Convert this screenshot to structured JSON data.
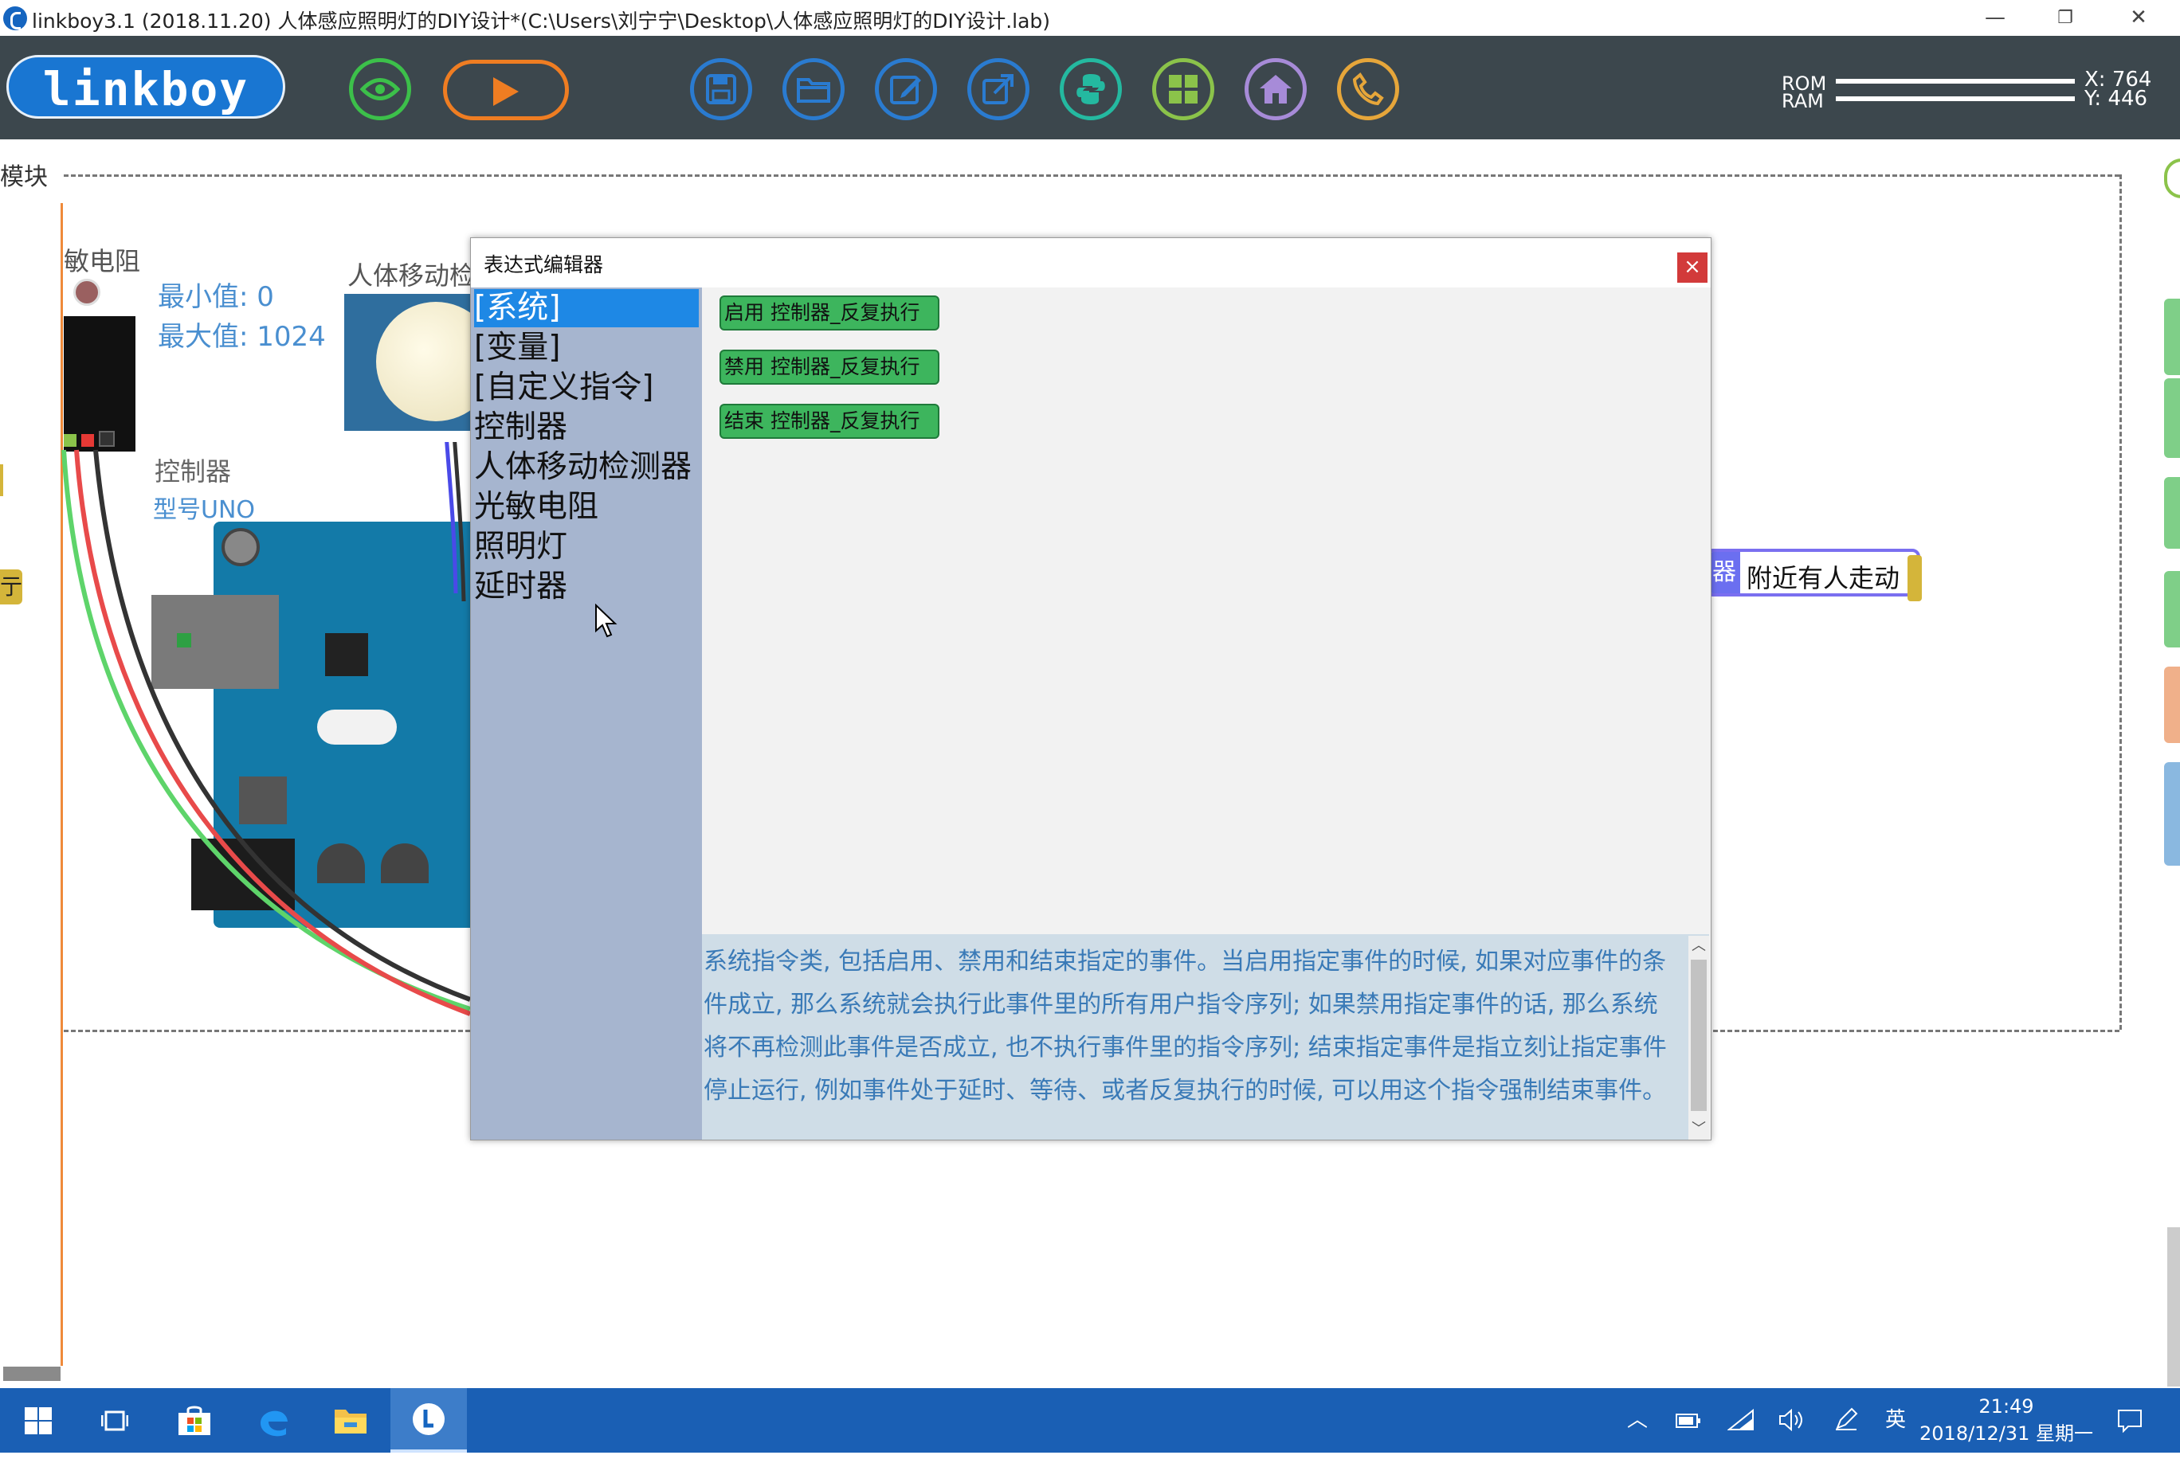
{
  "window": {
    "title": "linkboy3.1 (2018.11.20) 人体感应照明灯的DIY设计*(C:\\Users\\刘宁宁\\Desktop\\人体感应照明灯的DIY设计.lab)",
    "minimize": "—",
    "restore": "❐",
    "close": "✕"
  },
  "toolbar": {
    "logo": "linkboy",
    "buttons": [
      {
        "name": "view",
        "icon": "eye-icon",
        "color": "#3cc04a"
      },
      {
        "name": "run",
        "icon": "play-icon",
        "color": "#ef7d22"
      },
      {
        "name": "save",
        "icon": "save-icon",
        "color": "#2a7bd0"
      },
      {
        "name": "open",
        "icon": "folder-icon",
        "color": "#2a7bd0"
      },
      {
        "name": "edit",
        "icon": "edit-icon",
        "color": "#2a7bd0"
      },
      {
        "name": "export",
        "icon": "export-icon",
        "color": "#2a7bd0"
      },
      {
        "name": "python",
        "icon": "python-icon",
        "color": "#24b9a0"
      },
      {
        "name": "modules",
        "icon": "grid-icon",
        "color": "#8bc34a"
      },
      {
        "name": "home",
        "icon": "home-icon",
        "color": "#a78bd8"
      },
      {
        "name": "phone",
        "icon": "phone-icon",
        "color": "#e6a63a"
      }
    ],
    "rom_label": "ROM",
    "ram_label": "RAM",
    "x": "X: 764",
    "y": "Y: 446"
  },
  "canvas": {
    "module_label": "模块",
    "photoresistor_label": "敏电阻",
    "min_value": "最小值: 0",
    "max_value": "最大值: 1024",
    "pir_label": "人体移动检",
    "controller_label": "控制器",
    "controller_model": "型号UNO",
    "event_tag": "器",
    "event_text": "附近有人走动",
    "left_stub": "亍"
  },
  "dialog": {
    "title": "表达式编辑器",
    "close": "×",
    "categories": [
      "[系统]",
      "[变量]",
      "[自定义指令]",
      "控制器",
      "人体移动检测器",
      "光敏电阻",
      "照明灯",
      "延时器"
    ],
    "selected_category": 0,
    "commands": [
      "启用 控制器_反复执行",
      "禁用 控制器_反复执行",
      "结束 控制器_反复执行"
    ],
    "description": "系统指令类, 包括启用、禁用和结束指定的事件。当启用指定事件的时候, 如果对应事件的条件成立, 那么系统就会执行此事件里的所有用户指令序列; 如果禁用指定事件的话, 那么系统将不再检测此事件是否成立, 也不执行事件里的指令序列; 结束指定事件是指立刻让指定事件停止运行, 例如事件处于延时、等待、或者反复执行的时候, 可以用这个指令强制结束事件。"
  },
  "taskbar": {
    "apps": [
      "windows-start-icon",
      "task-view-icon",
      "store-icon",
      "edge-icon",
      "file-explorer-icon",
      "linkboy-icon"
    ],
    "ime": "英",
    "time": "21:49",
    "date": "2018/12/31 星期一"
  },
  "colors": {
    "toolbar_bg": "#3c474d",
    "logo_blue": "#1976d2",
    "selected_category": "#1e88e5",
    "sidebar_bg": "#a6b5cf",
    "command_green": "#3db55d",
    "description_text": "#3a7ab7",
    "taskbar_bg": "#1a5fb4"
  }
}
